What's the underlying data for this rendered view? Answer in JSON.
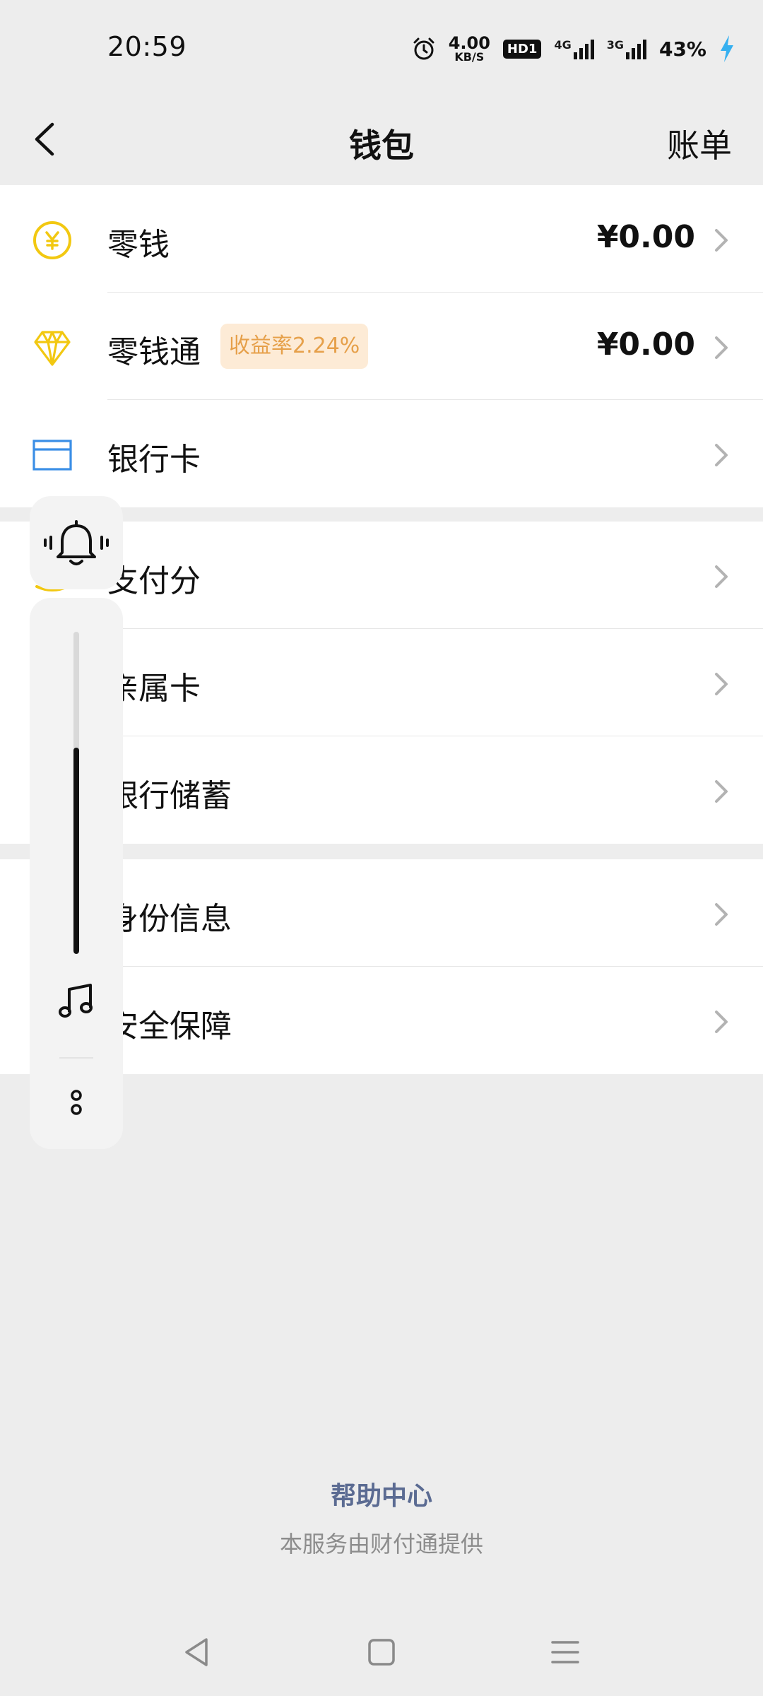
{
  "status_bar": {
    "time": "20:59",
    "net_speed_value": "4.00",
    "net_speed_unit": "KB/S",
    "hd_label": "HD1",
    "sim1": "4G",
    "sim2": "3G",
    "battery": "43%"
  },
  "header": {
    "title": "钱包",
    "right_action": "账单",
    "back_icon": "chevron-left-icon"
  },
  "groups": [
    {
      "items": [
        {
          "label": "零钱",
          "value": "¥0.00",
          "icon": "yen-coin-icon"
        },
        {
          "label": "零钱通",
          "badge": "收益率2.24%",
          "value": "¥0.00",
          "icon": "diamond-icon"
        },
        {
          "label": "银行卡",
          "icon": "bank-card-icon"
        }
      ]
    },
    {
      "items": [
        {
          "label": "支付分"
        },
        {
          "label": "亲属卡"
        },
        {
          "label": "银行储蓄"
        }
      ]
    },
    {
      "items": [
        {
          "label": "身份信息"
        },
        {
          "label": "安全保障"
        }
      ]
    }
  ],
  "volume_widget": {
    "level": 0.64
  },
  "footer": {
    "help_link": "帮助中心",
    "provider": "本服务由财付通提供"
  },
  "colors": {
    "background": "#ededed",
    "coin_yellow": "#f2c811",
    "card_blue": "#3a8ee6",
    "badge_bg": "#fdebd6",
    "badge_text": "#e6a04a",
    "help_link": "#5b6b92"
  }
}
